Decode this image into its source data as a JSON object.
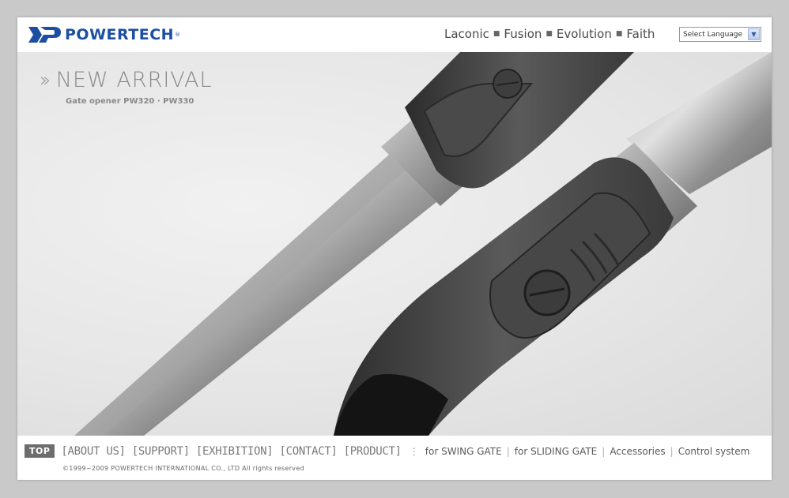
{
  "brand": {
    "name": "POWERTECH",
    "registered": "®",
    "color": "#1c4fa3"
  },
  "slogan": [
    "Laconic",
    "Fusion",
    "Evolution",
    "Faith"
  ],
  "language_select": {
    "value": "Select Language"
  },
  "hero": {
    "title": "NEW ARRIVAL",
    "subtitle": "Gate opener PW320 · PW330",
    "image": "two gate opener actuators (PW320, PW330)"
  },
  "footer": {
    "top_label": "TOP",
    "main_links": [
      "[ABOUT US]",
      "[SUPPORT]",
      "[EXHIBITION]",
      "[CONTACT]",
      "[PRODUCT]"
    ],
    "sub_links": [
      "for SWING GATE",
      "for SLIDING GATE",
      "Accessories",
      "Control system"
    ],
    "copyright": "©1999~2009 POWERTECH INTERNATIONAL CO., LTD All rights reserved"
  }
}
